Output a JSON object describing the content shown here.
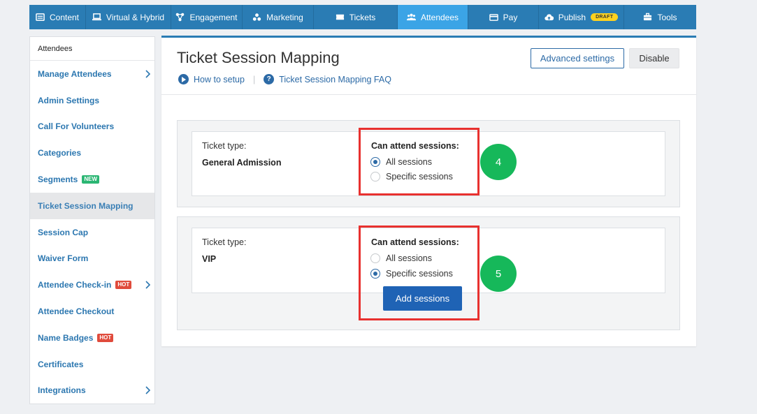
{
  "topnav": {
    "tabs": [
      {
        "label": "Content",
        "icon": "content-icon"
      },
      {
        "label": "Virtual & Hybrid",
        "icon": "monitor-icon"
      },
      {
        "label": "Engagement",
        "icon": "engagement-icon"
      },
      {
        "label": "Marketing",
        "icon": "marketing-icon"
      },
      {
        "label": "Tickets",
        "icon": "ticket-icon"
      },
      {
        "label": "Attendees",
        "icon": "attendees-icon",
        "active": true
      },
      {
        "label": "Pay",
        "icon": "credit-card-icon"
      },
      {
        "label": "Publish",
        "icon": "cloud-upload-icon",
        "badge": "DRAFT"
      },
      {
        "label": "Tools",
        "icon": "toolbox-icon"
      }
    ],
    "colors": {
      "bar": "#2a7cb4",
      "active": "#3ba4e6"
    }
  },
  "sidebar": {
    "heading": "Attendees",
    "items": [
      {
        "label": "Manage Attendees",
        "chevron": true
      },
      {
        "label": "Admin Settings"
      },
      {
        "label": "Call For Volunteers"
      },
      {
        "label": "Categories"
      },
      {
        "label": "Segments",
        "badge": "NEW"
      },
      {
        "label": "Ticket Session Mapping",
        "active": true
      },
      {
        "label": "Session Cap"
      },
      {
        "label": "Waiver Form"
      },
      {
        "label": "Attendee Check-in",
        "badge": "HOT",
        "chevron": true
      },
      {
        "label": "Attendee Checkout"
      },
      {
        "label": "Name Badges",
        "badge": "HOT"
      },
      {
        "label": "Certificates"
      },
      {
        "label": "Integrations",
        "chevron": true
      }
    ]
  },
  "main": {
    "title": "Ticket Session Mapping",
    "links": {
      "setup": "How to setup",
      "separator": "|",
      "faq": "Ticket Session Mapping FAQ"
    },
    "buttons": {
      "advanced": "Advanced settings",
      "disable": "Disable"
    },
    "tickets": [
      {
        "type_label": "Ticket type:",
        "type_value": "General Admission",
        "sessions_label": "Can attend sessions:",
        "options": {
          "all": "All sessions",
          "specific": "Specific sessions"
        },
        "selected": "all",
        "step": "4"
      },
      {
        "type_label": "Ticket type:",
        "type_value": "VIP",
        "sessions_label": "Can attend sessions:",
        "options": {
          "all": "All sessions",
          "specific": "Specific sessions"
        },
        "selected": "specific",
        "add_button": "Add sessions",
        "step": "5"
      }
    ]
  },
  "colors": {
    "accent": "#2c6aa6",
    "highlight_box": "#e8312f",
    "step_marker": "#16b85a",
    "primary_button": "#1f63b5"
  }
}
